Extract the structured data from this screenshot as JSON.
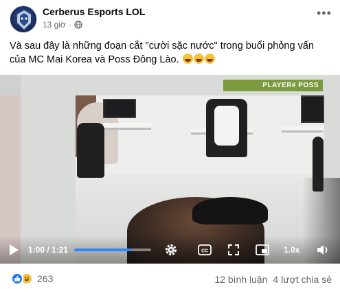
{
  "header": {
    "page_name": "Cerberus Esports LOL",
    "time": "13 giờ",
    "separator": "·",
    "icons": {
      "avatar": "cerberus-logo",
      "privacy": "globe-icon",
      "more": "more-options-icon"
    }
  },
  "post": {
    "caption": "Và sau đây là những đoạn cắt \"cười sặc nước\" trong buổi phỏng vấn của MC Mai Korea và Poss Đông Lào.",
    "caption_emojis": [
      "rolling-laughing-emoji",
      "rolling-laughing-emoji",
      "rolling-laughing-emoji"
    ]
  },
  "video": {
    "overlay_tag": "PLAYER# POSS",
    "time_display": "1:00 / 1:21",
    "progress": 0.74,
    "speed": "1.0x",
    "icons": [
      "play-icon",
      "settings-gear-icon",
      "captions-icon",
      "fullscreen-icon",
      "picture-in-picture-icon",
      "volume-icon"
    ],
    "colors": {
      "accent": "#2d88ff",
      "tag_bg": "#7b9a3e"
    }
  },
  "footer": {
    "reaction_count": "263",
    "reaction_icons": [
      "like-icon",
      "haha-icon"
    ],
    "comments": "12 bình luận",
    "shares": "4 lượt chia sẻ"
  }
}
